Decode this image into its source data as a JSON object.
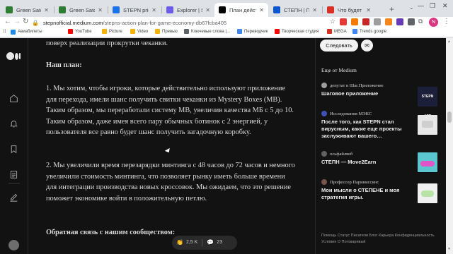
{
  "tabs": [
    {
      "title": "Green Satoshi",
      "color": "#2e7d32"
    },
    {
      "title": "Green Satoshi",
      "color": "#2e7d32"
    },
    {
      "title": "STEPN price to",
      "color": "#1a73e8"
    },
    {
      "title": "Explorer | Solr",
      "color": "#6c5ce7"
    },
    {
      "title": "План действ…",
      "color": "#000000",
      "active": true
    },
    {
      "title": "СТЕПН | Публ…",
      "color": "#0b57d0"
    },
    {
      "title": "Что будет со…",
      "color": "#d93025"
    }
  ],
  "url": {
    "host": "stepnofficial.medium.com",
    "path": "/stepns-action-plan-for-game-economy-db67fcba405"
  },
  "bookmarks": [
    {
      "label": "Авиабилеты",
      "color": "#1e88e5"
    },
    {
      "label": "YouTube",
      "color": "#ff0000"
    },
    {
      "label": "Picture",
      "color": "#f4b400"
    },
    {
      "label": "Video",
      "color": "#f4b400"
    },
    {
      "label": "Превью",
      "color": "#f4b400"
    },
    {
      "label": "Ключевые слова |…",
      "color": "#5f6368"
    },
    {
      "label": "Переводчик",
      "color": "#4285f4"
    },
    {
      "label": "Творческая студия",
      "color": "#ff0000"
    },
    {
      "label": "MEGA",
      "color": "#d93025"
    },
    {
      "label": "Trends google",
      "color": "#4285f4"
    }
  ],
  "profile_initial": "N",
  "article": {
    "line_top": "поверх реализации прокрутки чеканки.",
    "plan_heading": "Наш план:",
    "para1": "1. Мы хотим, чтобы игроки, которые действительно используют приложение для перехода, имели шанс получить свитки чеканки из Mystery Boxes (MB). Таким образом, мы переработали систему MB, увеличив качества МБ с 5 до 10. Таким образом, даже имея всего пару обычных ботинок с 2 энергией, у пользователя все равно будет шанс получить загадочную коробку.",
    "para2": "2. Мы увеличили время перезарядки минтинга с 48 часов до 72 часов и немного увеличили стоимость минтинга, что позволяет рынку иметь больше времени для интеграции производства новых кроссовок. Мы ожидаем, что это решение поможет экономике войти в положительную петлю.",
    "feedback_heading": "Обратная связь с нашим сообществом:"
  },
  "actions": {
    "claps": "2,5 K",
    "comments": "23"
  },
  "sidebar": {
    "follow_label": "Следовать",
    "more_heading": "Еще от Medium",
    "stories": [
      {
        "author": "депутат в Шаг.Приложение",
        "title": "Шаговое приложение",
        "avatar": "#9e9e9e",
        "thumb": "#1b1f3a",
        "thumb_text": "STEPN APP"
      },
      {
        "author": "Исследования МЭКС",
        "title": "После того, как STEPN стал вирусным, какие еще проекты заслуживают вашего…",
        "avatar": "#3f51b5",
        "thumb": "#e8e8e8",
        "thumb_text": ""
      },
      {
        "author": "осьфайлвеб",
        "title": "СТЕПН — Move2Earn",
        "avatar": "#616161",
        "thumb": "#5cc6d0",
        "thumb_text": ""
      },
      {
        "author": "Профессор Париниссинс",
        "title": "Мои мысли о СТЕПЕНЕ и моя стратегия игры.",
        "avatar": "#795548",
        "thumb": "#f0f0f0",
        "thumb_text": ""
      }
    ],
    "footer": "Помощь  Статус  Писатели  Блог  Карьера  Конфиденциальность  Условия  О  Поговаривый"
  }
}
